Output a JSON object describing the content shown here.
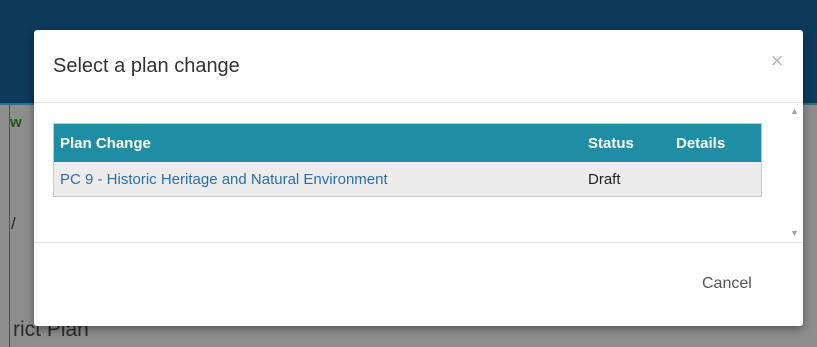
{
  "background": {
    "fragment_left": "w",
    "fragment_mid": "/",
    "fragment_bottom": "rict Plan"
  },
  "modal": {
    "title": "Select a plan change",
    "close_label": "×",
    "table": {
      "columns": [
        "Plan Change",
        "Status",
        "Details"
      ],
      "rows": [
        {
          "plan_change": "PC 9 - Historic Heritage and Natural Environment",
          "status": "Draft",
          "details": ""
        }
      ]
    },
    "cancel_label": "Cancel"
  },
  "scrollbar": {
    "up_arrow": "▲",
    "down_arrow": "▼"
  },
  "colors": {
    "table_header": "#1f8da3",
    "link": "#2b6fa8",
    "page_header": "#0e3a5c"
  }
}
